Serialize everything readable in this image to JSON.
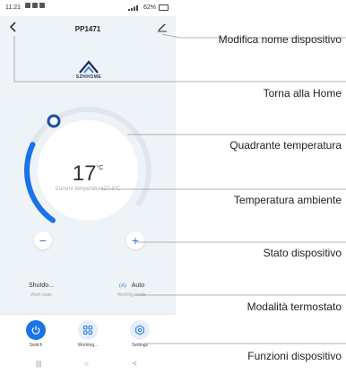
{
  "status_bar": {
    "time": "11:21",
    "battery": "62%"
  },
  "header": {
    "title": "PP1471"
  },
  "brand": {
    "name": "SZHHOME"
  },
  "thermostat": {
    "temperature": "17",
    "unit": "°C",
    "current_temperature": "Current temperature27-3°C",
    "accent_color": "#1a73e8",
    "minus_label": "−",
    "plus_label": "+"
  },
  "states": {
    "work_state_value": "Shutdo...",
    "work_state_label": "Work state",
    "working_mode_value": "Auto",
    "working_mode_icon_text": "(A)",
    "working_mode_label": "Working mode"
  },
  "bottom_bar": {
    "items": [
      {
        "label": "Switch",
        "icon": "power-icon"
      },
      {
        "label": "Working...",
        "icon": "grid-icon"
      },
      {
        "label": "Settings",
        "icon": "gear-icon"
      }
    ]
  },
  "nav": {
    "recent": "|||",
    "home": "○",
    "back": "<"
  },
  "annotations": {
    "edit_name": "Modifica nome dispositivo",
    "back_home": "Torna alla Home",
    "dial": "Quadrante temperatura",
    "ambient": "Temperatura ambiente",
    "device_state": "Stato dispositivo",
    "mode": "Modalità termostato",
    "functions": "Funzioni dispositivo"
  },
  "colors": {
    "primary": "#1a73e8",
    "background": "#eef3f8"
  }
}
